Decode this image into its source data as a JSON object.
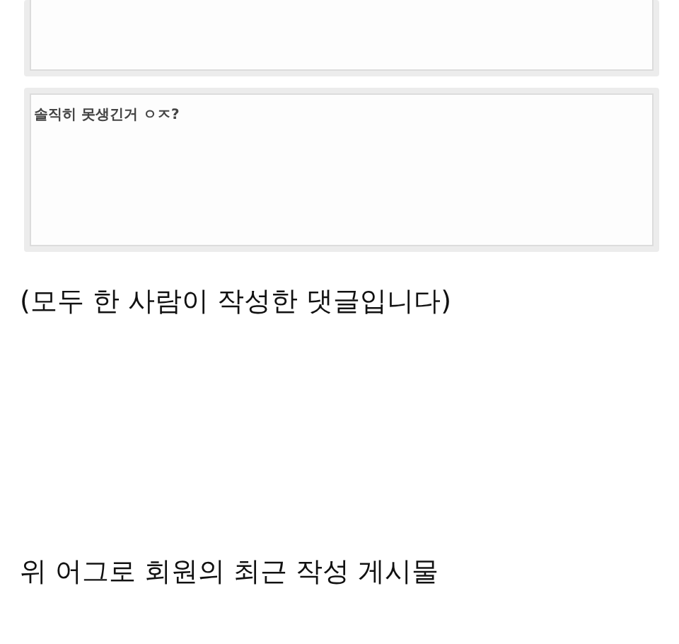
{
  "comment_boxes": [
    {
      "cut_off": true
    },
    {
      "cut_off": false,
      "text": "솔직히 못생긴거 ㅇㅈ?"
    }
  ],
  "caption": "(모두 한 사람이 작성한 댓글입니다)",
  "section_title": "위 어그로 회원의 최근 작성 게시물"
}
